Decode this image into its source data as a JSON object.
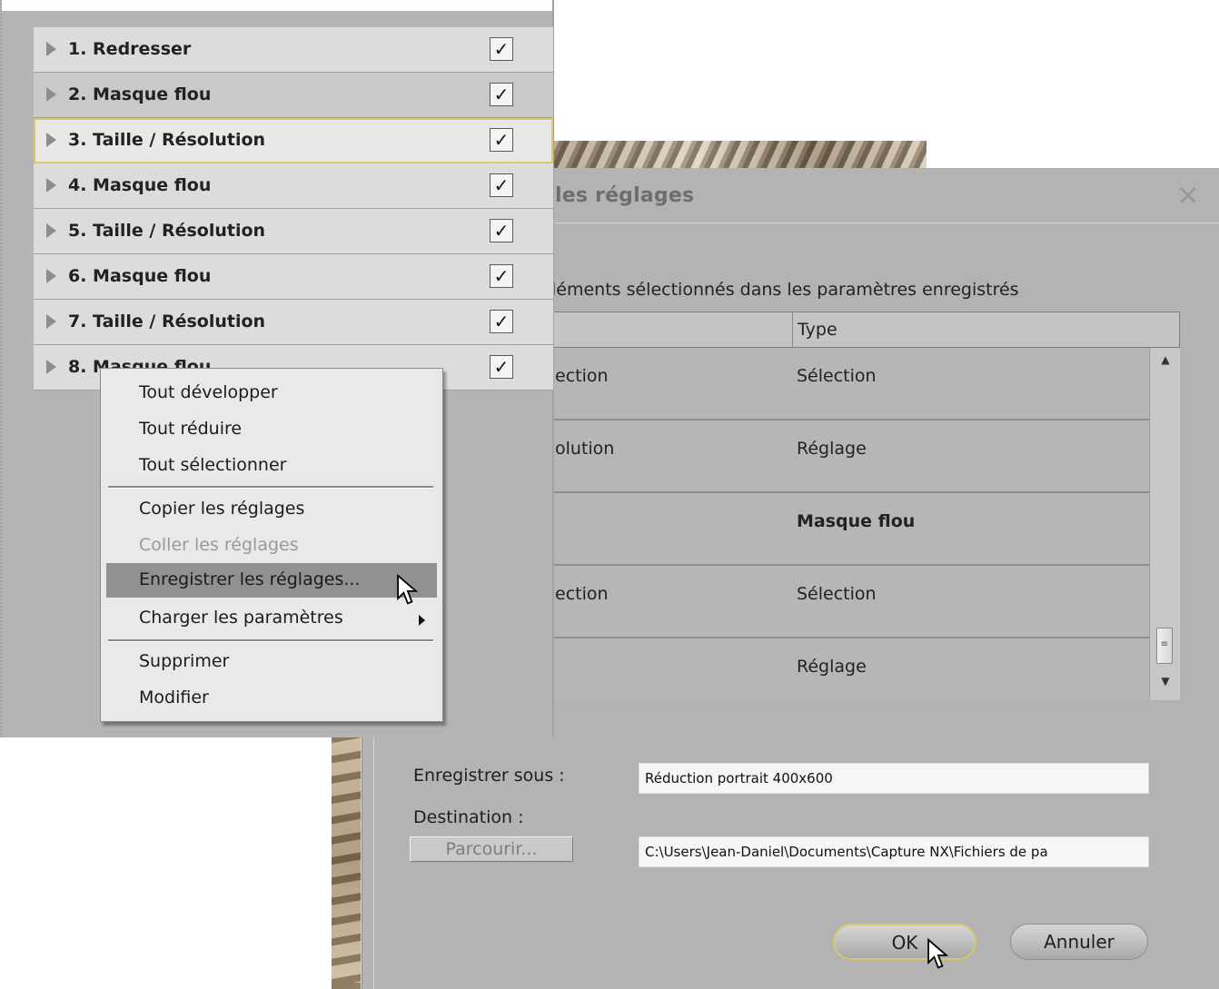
{
  "steps": [
    {
      "label": "1. Redresser",
      "checked": true
    },
    {
      "label": "2. Masque flou",
      "checked": true
    },
    {
      "label": "3. Taille / Résolution",
      "checked": true
    },
    {
      "label": "4. Masque flou",
      "checked": true
    },
    {
      "label": "5. Taille / Résolution",
      "checked": true
    },
    {
      "label": "6. Masque flou",
      "checked": true
    },
    {
      "label": "7. Taille / Résolution",
      "checked": true
    },
    {
      "label": "8. Masque flou",
      "checked": true
    }
  ],
  "checkmark": "✓",
  "context_menu": {
    "items": [
      {
        "label": "Tout développer"
      },
      {
        "label": "Tout réduire"
      },
      {
        "label": "Tout sélectionner"
      },
      {
        "label": "Copier les réglages"
      },
      {
        "label": "Coller les réglages",
        "disabled": true
      },
      {
        "label": "Enregistrer les réglages...",
        "highlighted": true
      },
      {
        "label": "Charger les paramètres",
        "submenu": true
      },
      {
        "label": "Supprimer"
      },
      {
        "label": "Modifier"
      }
    ]
  },
  "dialog": {
    "title": "les réglages",
    "close_glyph": "✕",
    "instruction": "léments sélectionnés dans les paramètres enregistrés",
    "columns": {
      "type": "Type"
    },
    "rows": [
      {
        "name": "ection",
        "type": "Sélection"
      },
      {
        "name": "olution",
        "type": "Réglage"
      },
      {
        "name": "",
        "type": "Masque flou",
        "selected": true
      },
      {
        "name": "ection",
        "type": "Sélection"
      },
      {
        "name": "",
        "type": "Réglage"
      }
    ],
    "save_as_label": "Enregistrer sous :",
    "save_as_value": "Réduction portrait 400x600",
    "destination_label": "Destination :",
    "browse_label": "Parcourir...",
    "destination_value": "C:\\Users\\Jean-Daniel\\Documents\\Capture NX\\Fichiers de pa",
    "ok_label": "OK",
    "cancel_label": "Annuler"
  },
  "colors": {
    "focus_outline": "#dcc86c",
    "menu_highlight": "#919191"
  }
}
